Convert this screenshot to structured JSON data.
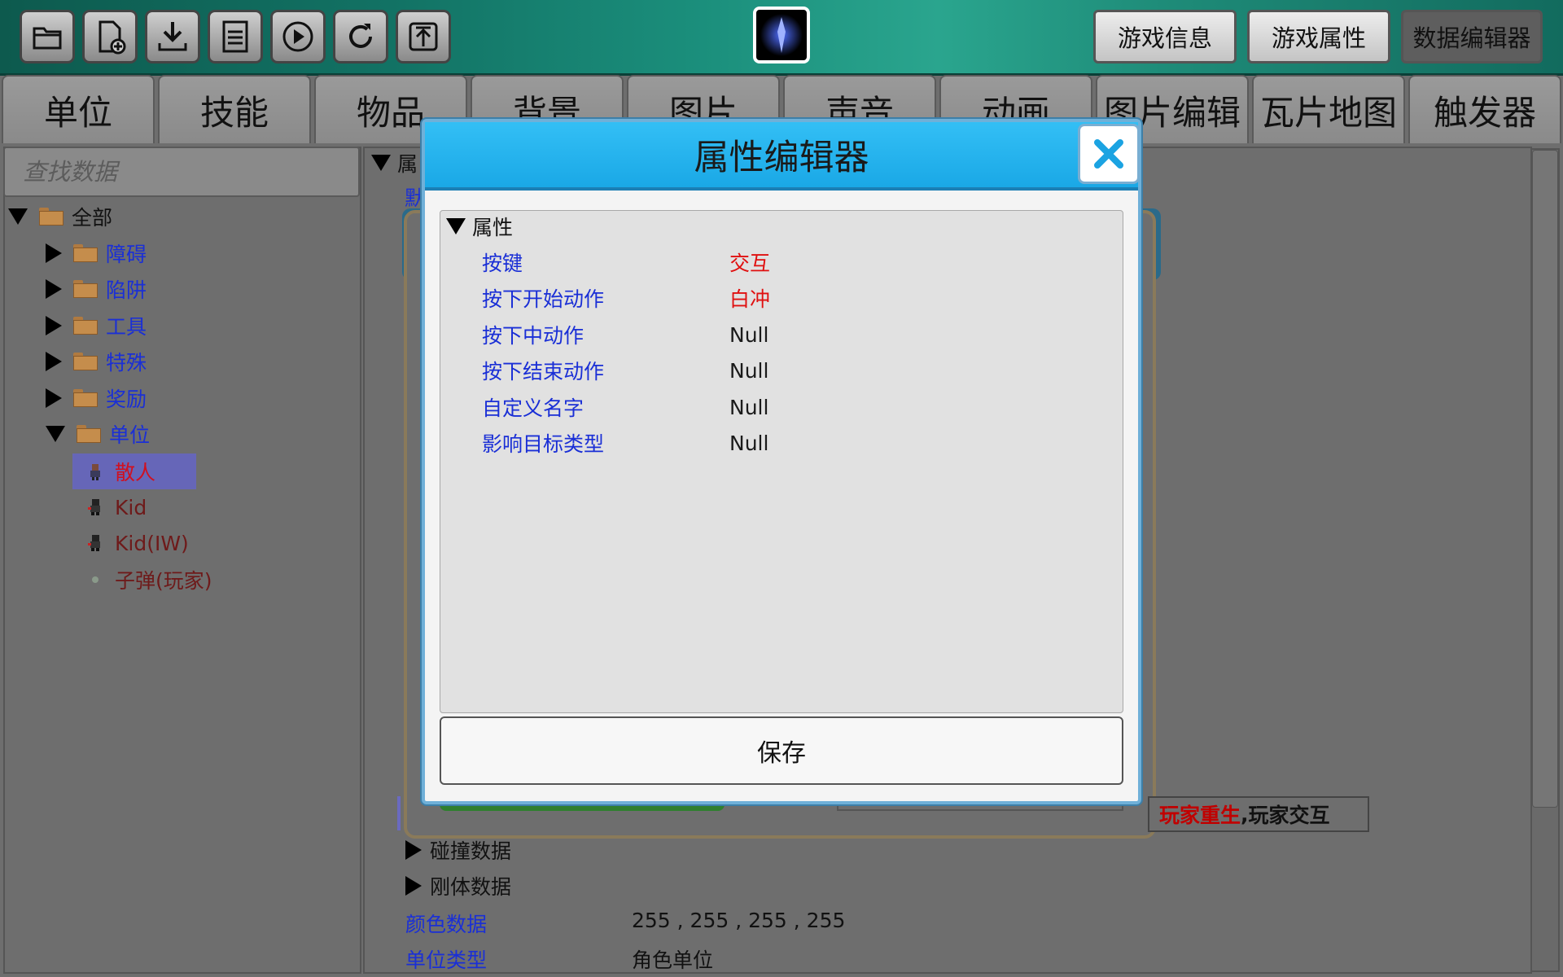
{
  "toolbar": {
    "icons": [
      "folder-open-icon",
      "new-file-icon",
      "download-icon",
      "save-disk-icon",
      "play-icon",
      "refresh-icon",
      "upload-icon"
    ],
    "game_icon": "game-logo-icon",
    "tabs": [
      {
        "label": "游戏信息",
        "active": false
      },
      {
        "label": "游戏属性",
        "active": false
      },
      {
        "label": "数据编辑器",
        "active": true
      }
    ]
  },
  "categories": [
    "单位",
    "技能",
    "物品",
    "背景",
    "图片",
    "声音",
    "动画",
    "图片编辑",
    "瓦片地图",
    "触发器"
  ],
  "search": {
    "placeholder": "查找数据"
  },
  "tree": {
    "root": "全部",
    "folders": [
      "障碍",
      "陷阱",
      "工具",
      "特殊",
      "奖励"
    ],
    "open_folder": "单位",
    "units": [
      {
        "label": "散人",
        "selected": true
      },
      {
        "label": "Kid",
        "selected": false
      },
      {
        "label": "Kid(IW)",
        "selected": false
      },
      {
        "label": "子弹(玩家)",
        "selected": false
      }
    ]
  },
  "background": {
    "section_header": "属",
    "default_prefix": "默",
    "trigger_red": "玩家重生",
    "trigger_sep": ",",
    "trigger_dark": "玩家交互",
    "collision_data": "碰撞数据",
    "rigidbody_data": "刚体数据",
    "color_label": "颜色数据",
    "color_value": "255 , 255 , 255 , 255",
    "unit_type_label": "单位类型",
    "unit_type_value": "角色单位"
  },
  "dialog": {
    "title": "属性编辑器",
    "section": "属性",
    "properties": [
      {
        "key": "按键",
        "value": "交互",
        "highlight": true
      },
      {
        "key": "按下开始动作",
        "value": "白冲",
        "highlight": true
      },
      {
        "key": "按下中动作",
        "value": "Null",
        "highlight": false
      },
      {
        "key": "按下结束动作",
        "value": "Null",
        "highlight": false
      },
      {
        "key": "自定义名字",
        "value": "Null",
        "highlight": false
      },
      {
        "key": "影响目标类型",
        "value": "Null",
        "highlight": false
      }
    ],
    "save_label": "保存"
  },
  "colors": {
    "dialog_header": "#1aa8e6",
    "key_blue": "#1a2fd6",
    "value_red": "#e01010",
    "selected_bg": "#6666b8"
  }
}
